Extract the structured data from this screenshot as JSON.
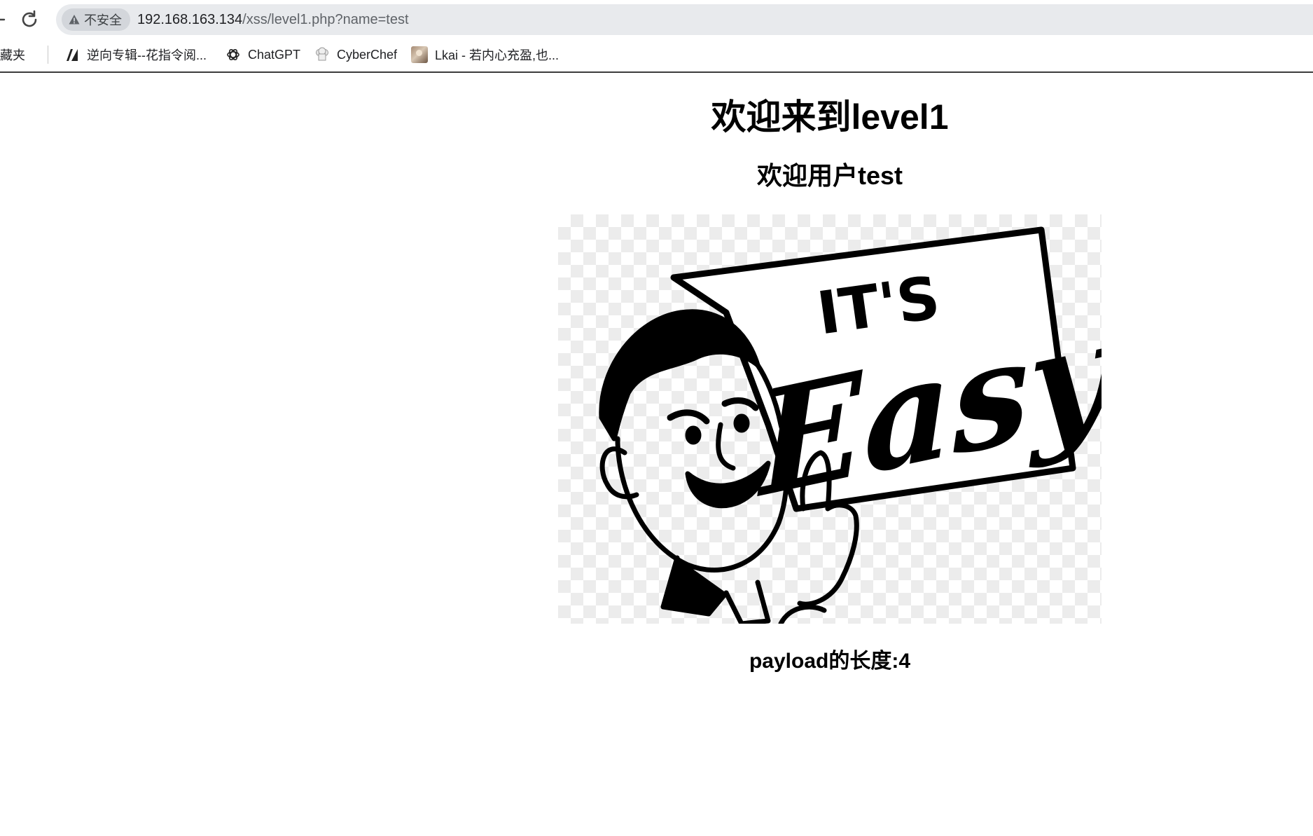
{
  "browser": {
    "security_label": "不安全",
    "url_host": "192.168.163.134",
    "url_path": "/xss/level1.php?name=test",
    "icons": {
      "reload": "reload-icon",
      "security": "warning-triangle-icon"
    }
  },
  "bookmarks_bar": {
    "folder_label": "收藏夹",
    "items": [
      {
        "label": "逆向专辑--花指令阅...",
        "icon": "zhihu-style-icon"
      },
      {
        "label": "ChatGPT",
        "icon": "openai-icon"
      },
      {
        "label": "CyberChef",
        "icon": "chef-hat-icon"
      },
      {
        "label": "Lkai - 若内心充盈,也...",
        "icon": "photo-avatar-icon"
      }
    ]
  },
  "page": {
    "heading": "欢迎来到level1",
    "welcome": "欢迎用户test",
    "picture_text": {
      "line1": "IT'S",
      "line2": "Easy"
    },
    "payload_length": "payload的长度:4"
  }
}
